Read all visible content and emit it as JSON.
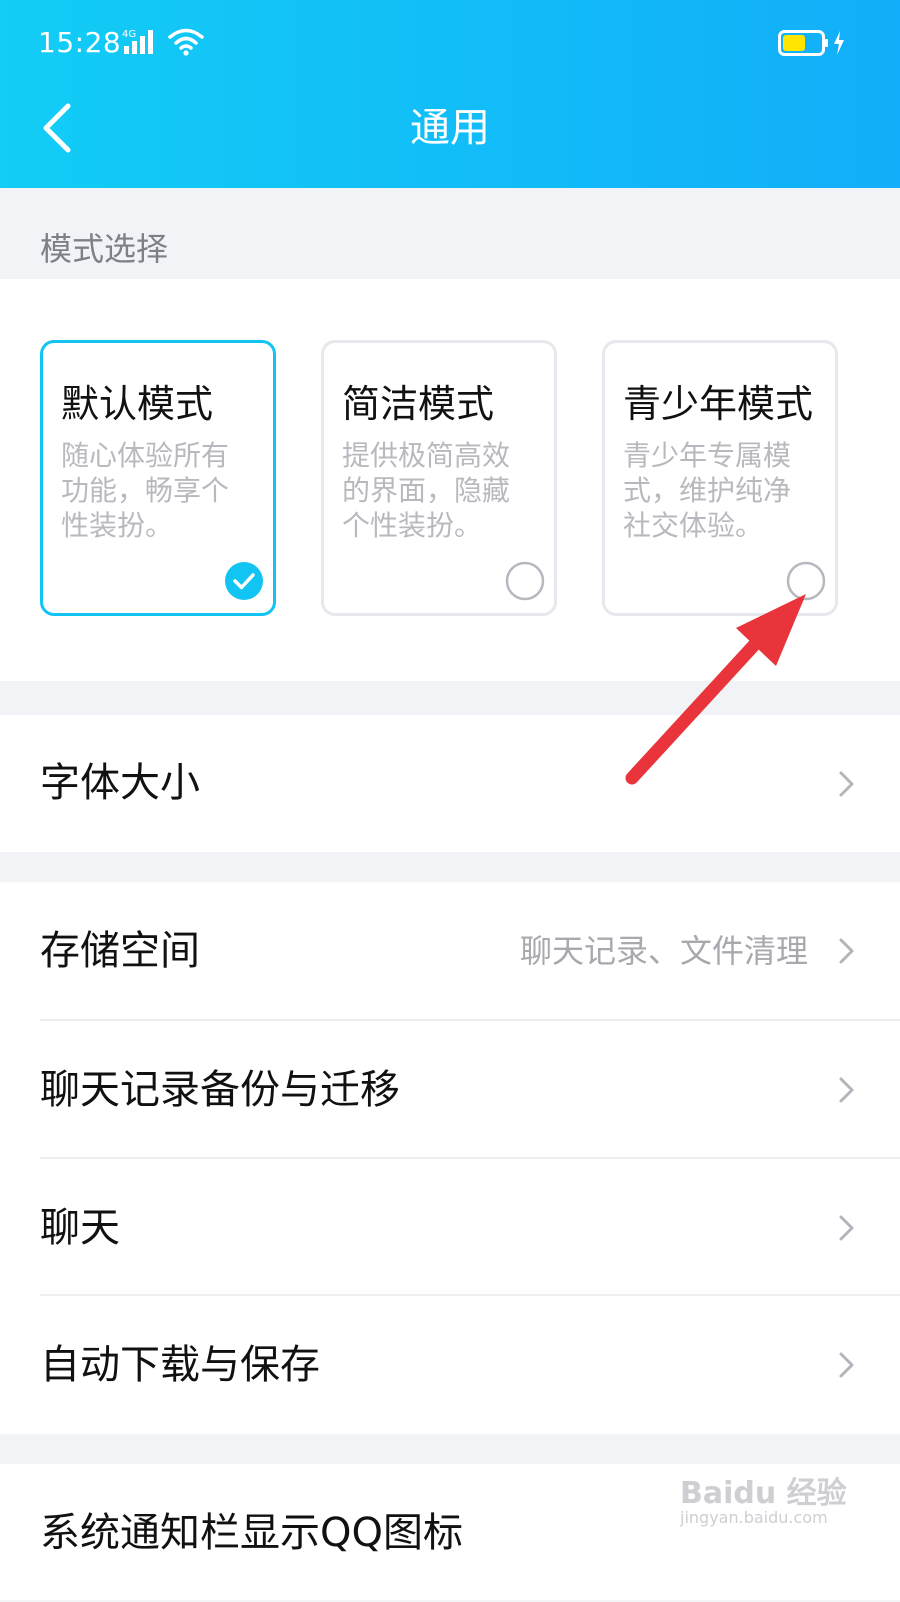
{
  "status_bar": {
    "time": "15:28",
    "network": "4G"
  },
  "header": {
    "title": "通用"
  },
  "mode_section": {
    "label": "模式选择",
    "cards": [
      {
        "title": "默认模式",
        "desc": "随心体验所有功能，畅享个性装扮。",
        "selected": true
      },
      {
        "title": "简洁模式",
        "desc": "提供极简高效的界面，隐藏个性装扮。",
        "selected": false
      },
      {
        "title": "青少年模式",
        "desc": "青少年专属模式，维护纯净社交体验。",
        "selected": false
      }
    ]
  },
  "settings": {
    "font_size": {
      "label": "字体大小"
    },
    "storage": {
      "label": "存储空间",
      "value": "聊天记录、文件清理"
    },
    "backup": {
      "label": "聊天记录备份与迁移"
    },
    "chat": {
      "label": "聊天"
    },
    "auto_download": {
      "label": "自动下载与保存"
    },
    "notification_icon": {
      "label": "系统通知栏显示QQ图标"
    }
  },
  "watermark": {
    "brand": "Baidu 经验",
    "url": "jingyan.baidu.com"
  },
  "colors": {
    "header_start": "#12cdf6",
    "header_end": "#12aef9",
    "accent": "#12c4f2",
    "annotation_arrow": "#e8343a",
    "battery": "#ffe500"
  }
}
